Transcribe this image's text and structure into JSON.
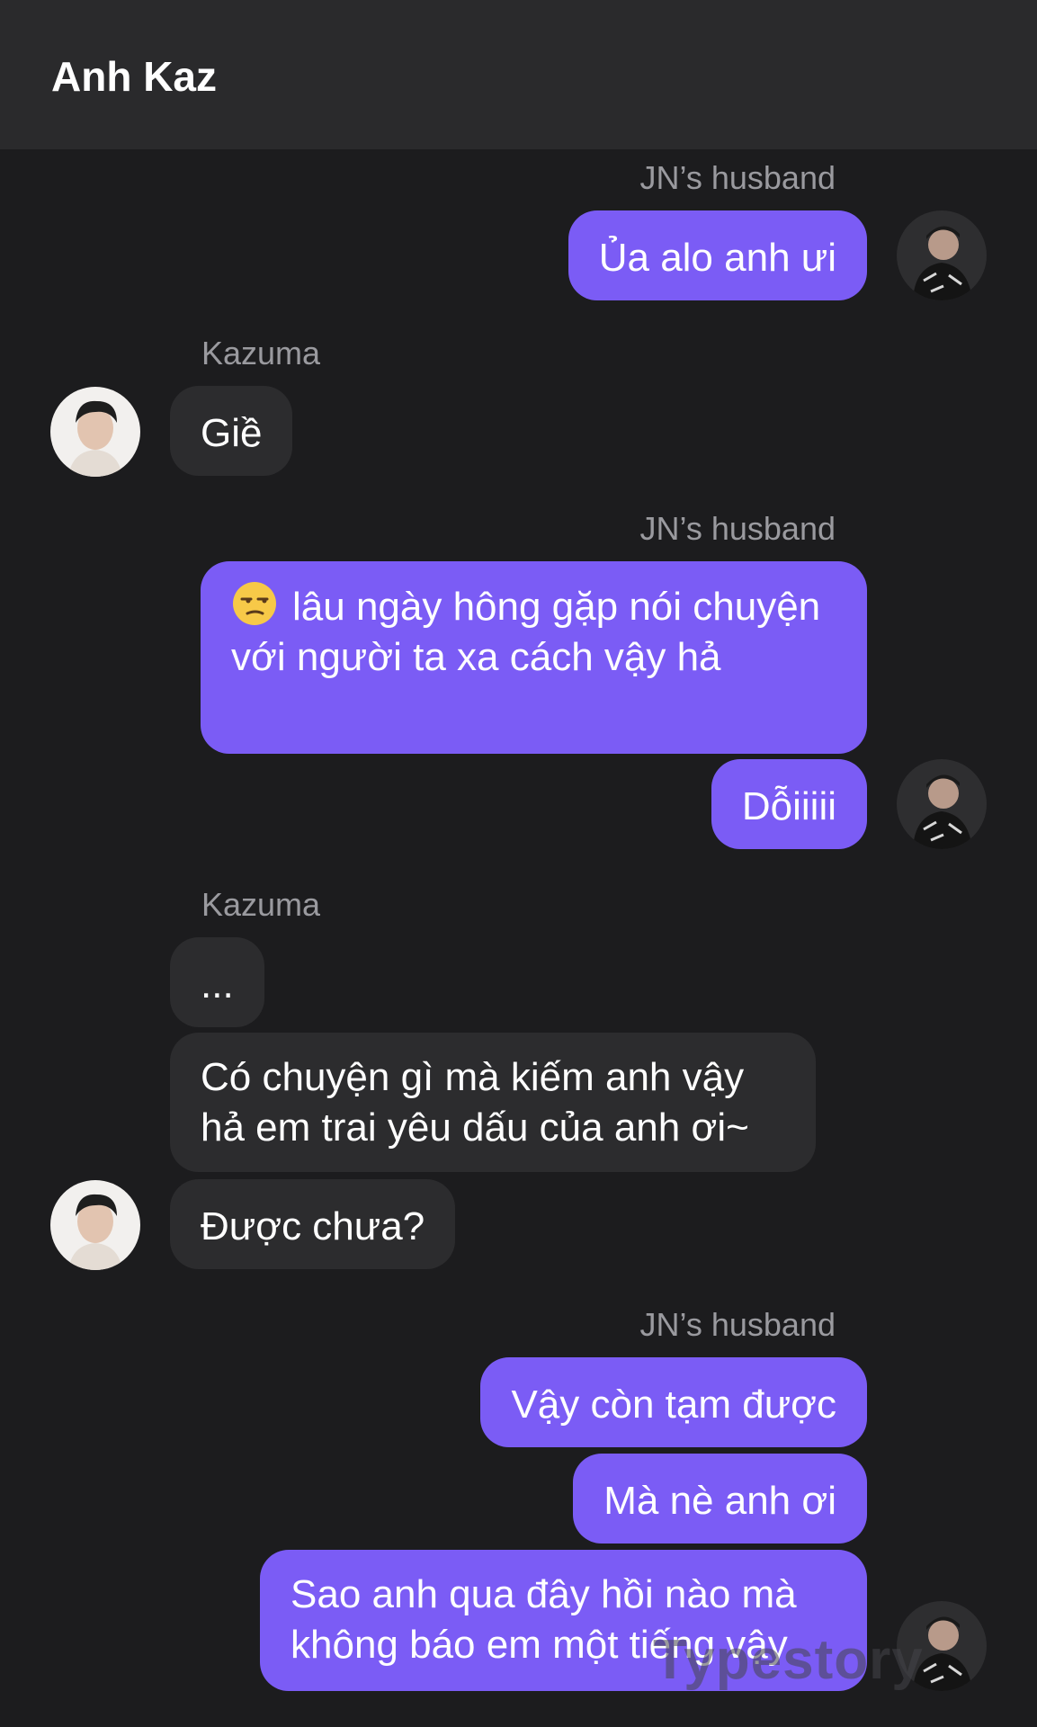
{
  "header": {
    "title": "Anh Kaz"
  },
  "senders": {
    "me": "JN’s husband",
    "them": "Kazuma"
  },
  "messages": [
    {
      "from": "me",
      "text": "Ủa alo anh ưi"
    },
    {
      "from": "them",
      "text": "Giề"
    },
    {
      "from": "me",
      "emoji": "unamused-face",
      "text": "lâu ngày hông gặp nói chuyện với người ta xa cách vậy hả"
    },
    {
      "from": "me",
      "text": "Dỗiiiii"
    },
    {
      "from": "them",
      "text": "..."
    },
    {
      "from": "them",
      "text": "Có chuyện gì mà kiếm anh vậy hả em trai yêu dấu của anh ơi~"
    },
    {
      "from": "them",
      "text": "Được chưa?"
    },
    {
      "from": "me",
      "text": "Vậy còn tạm được"
    },
    {
      "from": "me",
      "text": "Mà nè anh ơi"
    },
    {
      "from": "me",
      "text": "Sao anh qua đây hồi nào mà không báo em một tiếng vậy"
    }
  ],
  "watermark": "Typestory",
  "colors": {
    "outgoing_bubble": "#7b5cf5",
    "incoming_bubble": "#2c2c2e",
    "background": "#1c1c1e",
    "header": "#2a2a2c"
  }
}
